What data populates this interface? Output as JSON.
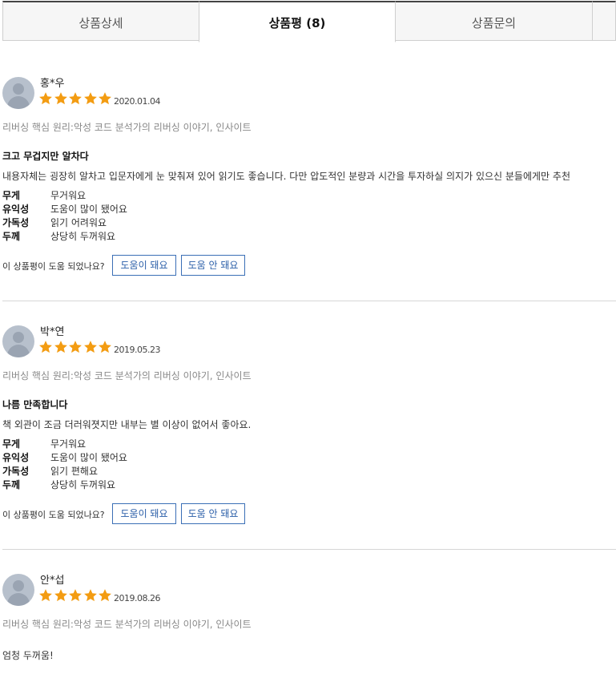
{
  "tabs": [
    {
      "label": "상품상세",
      "active": false
    },
    {
      "label": "상품평 (8)",
      "active": true
    },
    {
      "label": "상품문의",
      "active": false
    },
    {
      "label": "",
      "active": false
    }
  ],
  "star_color": "#f39c12",
  "helpful_button_color": "#3b6fb6",
  "reviews": [
    {
      "name": "홍*우",
      "rating": 5,
      "date": "2020.01.04",
      "book": "리버싱 핵심 원리:악성 코드 분석가의 리버싱 이야기, 인사이트",
      "title": "크고 무겁지만 알차다",
      "content": "내용자체는 굉장히 알차고 입문자에게 눈 맞춰져 있어 읽기도 좋습니다. 다만 압도적인 분량과 시간을 투자하실 의지가 있으신 분들에게만 추천",
      "attributes": [
        {
          "key": "무게",
          "value": "무거워요"
        },
        {
          "key": "유익성",
          "value": "도움이 많이 됐어요"
        },
        {
          "key": "가독성",
          "value": "읽기 어려워요"
        },
        {
          "key": "두께",
          "value": "상당히 두꺼워요"
        }
      ],
      "helpful_question": "이 상품평이 도움 되었나요?",
      "helpful_yes": "도움이 돼요",
      "helpful_no": "도움 안 돼요"
    },
    {
      "name": "박*연",
      "rating": 5,
      "date": "2019.05.23",
      "book": "리버싱 핵심 원리:악성 코드 분석가의 리버싱 이야기, 인사이트",
      "title": "나름 만족합니다",
      "content": "책 외관이 조금 더러워졋지만 내부는 별 이상이 없어서 좋아요.",
      "attributes": [
        {
          "key": "무게",
          "value": "무거워요"
        },
        {
          "key": "유익성",
          "value": "도움이 많이 됐어요"
        },
        {
          "key": "가독성",
          "value": "읽기 편해요"
        },
        {
          "key": "두께",
          "value": "상당히 두꺼워요"
        }
      ],
      "helpful_question": "이 상품평이 도움 되었나요?",
      "helpful_yes": "도움이 돼요",
      "helpful_no": "도움 안 돼요"
    },
    {
      "name": "안*섭",
      "rating": 5,
      "date": "2019.08.26",
      "book": "리버싱 핵심 원리:악성 코드 분석가의 리버싱 이야기, 인사이트",
      "title": "",
      "content": "엄청 두꺼움!"
    }
  ]
}
